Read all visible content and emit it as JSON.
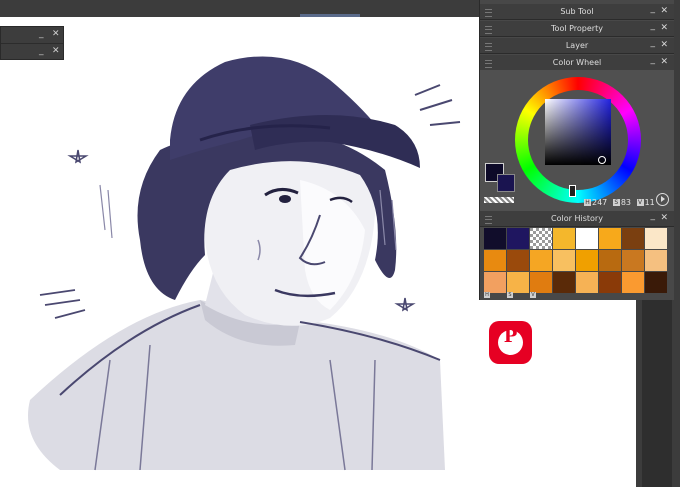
{
  "window_controls": {
    "minimize": "_",
    "close": "✕"
  },
  "panels": {
    "sub_tool": "Sub Tool",
    "tool_property": "Tool Property",
    "layer": "Layer",
    "color_wheel": "Color Wheel",
    "color_history": "Color History"
  },
  "color_wheel": {
    "main_color": "#0d0a28",
    "sub_color": "#1a1450",
    "h_label": "H",
    "h_value": "247",
    "s_label": "S",
    "s_value": "83",
    "v_label": "V",
    "v_value": "11"
  },
  "color_history": {
    "swatches": [
      "#110d2b",
      "#1f1660",
      "checker",
      "#f4b72c",
      "#ffffff",
      "#f7a91b",
      "#7a3f10",
      "#fbe7c8",
      "#e88a10",
      "#9a4a0c",
      "#f5a623",
      "#f8c060",
      "#f0a000",
      "#b86a10",
      "#c97820",
      "#f5c080",
      "#f2a060",
      "#f7b347",
      "#e07c10",
      "#5a2a08",
      "#f6b255",
      "#8a3a08",
      "#fa9a30",
      "#3a1a08"
    ],
    "mode_labels": [
      "H",
      "S",
      "V"
    ]
  },
  "pinterest": {
    "glyph": "P",
    "color": "#e60023"
  },
  "icons": [
    "grip-icon",
    "minimize-icon",
    "close-icon",
    "play-icon",
    "pinterest-icon"
  ]
}
